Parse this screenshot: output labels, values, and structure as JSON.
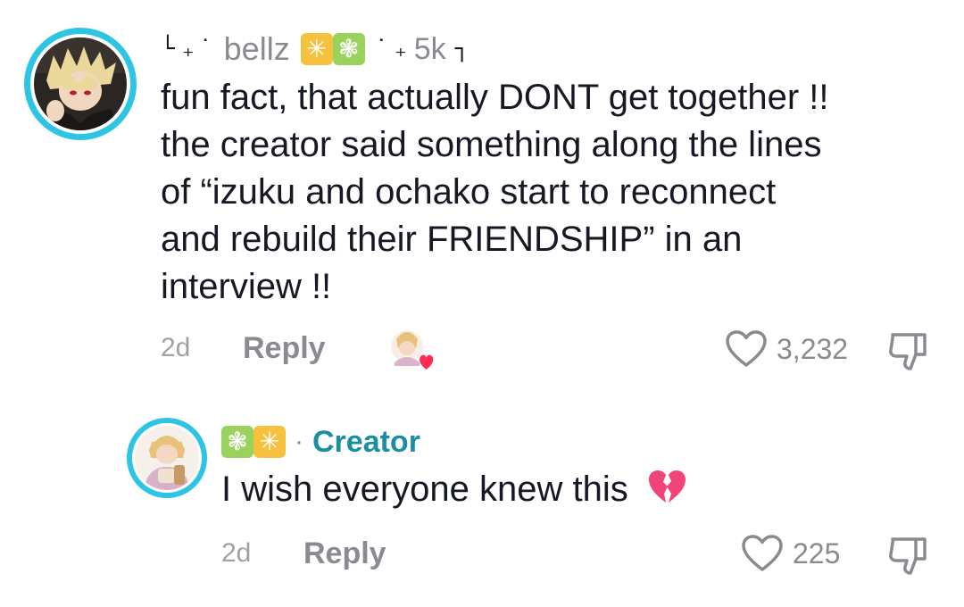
{
  "comment": {
    "username": "bellz",
    "badges": [
      "sparkle-orange",
      "sparkle-green"
    ],
    "deco_left": "└ ₊",
    "deco_mid": "˙ ₊",
    "follow_count": "5k",
    "deco_right": "┐",
    "text": "fun fact, that actually DONT get together !!\nthe creator said something along the lines\nof “izuku and ochako start to reconnect\nand rebuild their FRIENDSHIP” in an\ninterview !!",
    "time": "2d",
    "reply_label": "Reply",
    "likes": "3,232",
    "creator_liked": true
  },
  "reply": {
    "badges": [
      "sparkle-green",
      "sparkle-orange"
    ],
    "separator": "·",
    "creator_label": "Creator",
    "text": "I wish everyone knew this",
    "emoji": "💔",
    "time": "2d",
    "reply_label": "Reply",
    "likes": "225"
  },
  "colors": {
    "avatar_ring": "#2ec4e4",
    "creator_tag": "#1a8fa0",
    "like_heart": "#fe2c55",
    "muted_text": "#8a8b91"
  }
}
